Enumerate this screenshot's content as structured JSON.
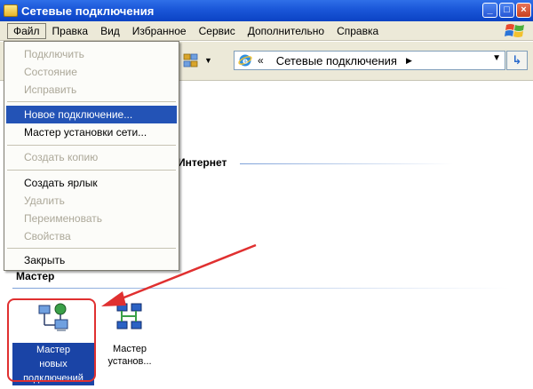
{
  "window": {
    "title": "Сетевые подключения"
  },
  "window_buttons": {
    "minimize": "_",
    "maximize": "□",
    "close": "×"
  },
  "menubar": {
    "items": [
      "Файл",
      "Правка",
      "Вид",
      "Избранное",
      "Сервис",
      "Дополнительно",
      "Справка"
    ]
  },
  "address": {
    "text": "Сетевые подключения",
    "go": "↳"
  },
  "file_menu": {
    "items": [
      {
        "label": "Подключить",
        "enabled": false
      },
      {
        "label": "Состояние",
        "enabled": false
      },
      {
        "label": "Исправить",
        "enabled": false
      },
      {
        "label": "Новое подключение...",
        "enabled": true,
        "highlighted": true
      },
      {
        "label": "Мастер установки сети...",
        "enabled": true
      },
      {
        "label": "Создать копию",
        "enabled": false
      },
      {
        "label": "Создать ярлык",
        "enabled": true
      },
      {
        "label": "Удалить",
        "enabled": false
      },
      {
        "label": "Переименовать",
        "enabled": false
      },
      {
        "label": "Свойства",
        "enabled": false
      },
      {
        "label": "Закрыть",
        "enabled": true
      }
    ]
  },
  "groups": {
    "internet_header": "Интернет",
    "master_header": "Мастер"
  },
  "wizards": [
    {
      "label_lines": [
        "Мастер",
        "новых",
        "подключений"
      ],
      "selected": true,
      "icon": "new-connection-wizard-icon"
    },
    {
      "label_lines": [
        "Мастер",
        "установ..."
      ],
      "selected": false,
      "icon": "network-setup-wizard-icon"
    }
  ],
  "colors": {
    "titlebar": "#1a56d8",
    "menu_highlight": "#2353b6",
    "annotation_red": "#e03030",
    "selection": "#1a44a6"
  }
}
